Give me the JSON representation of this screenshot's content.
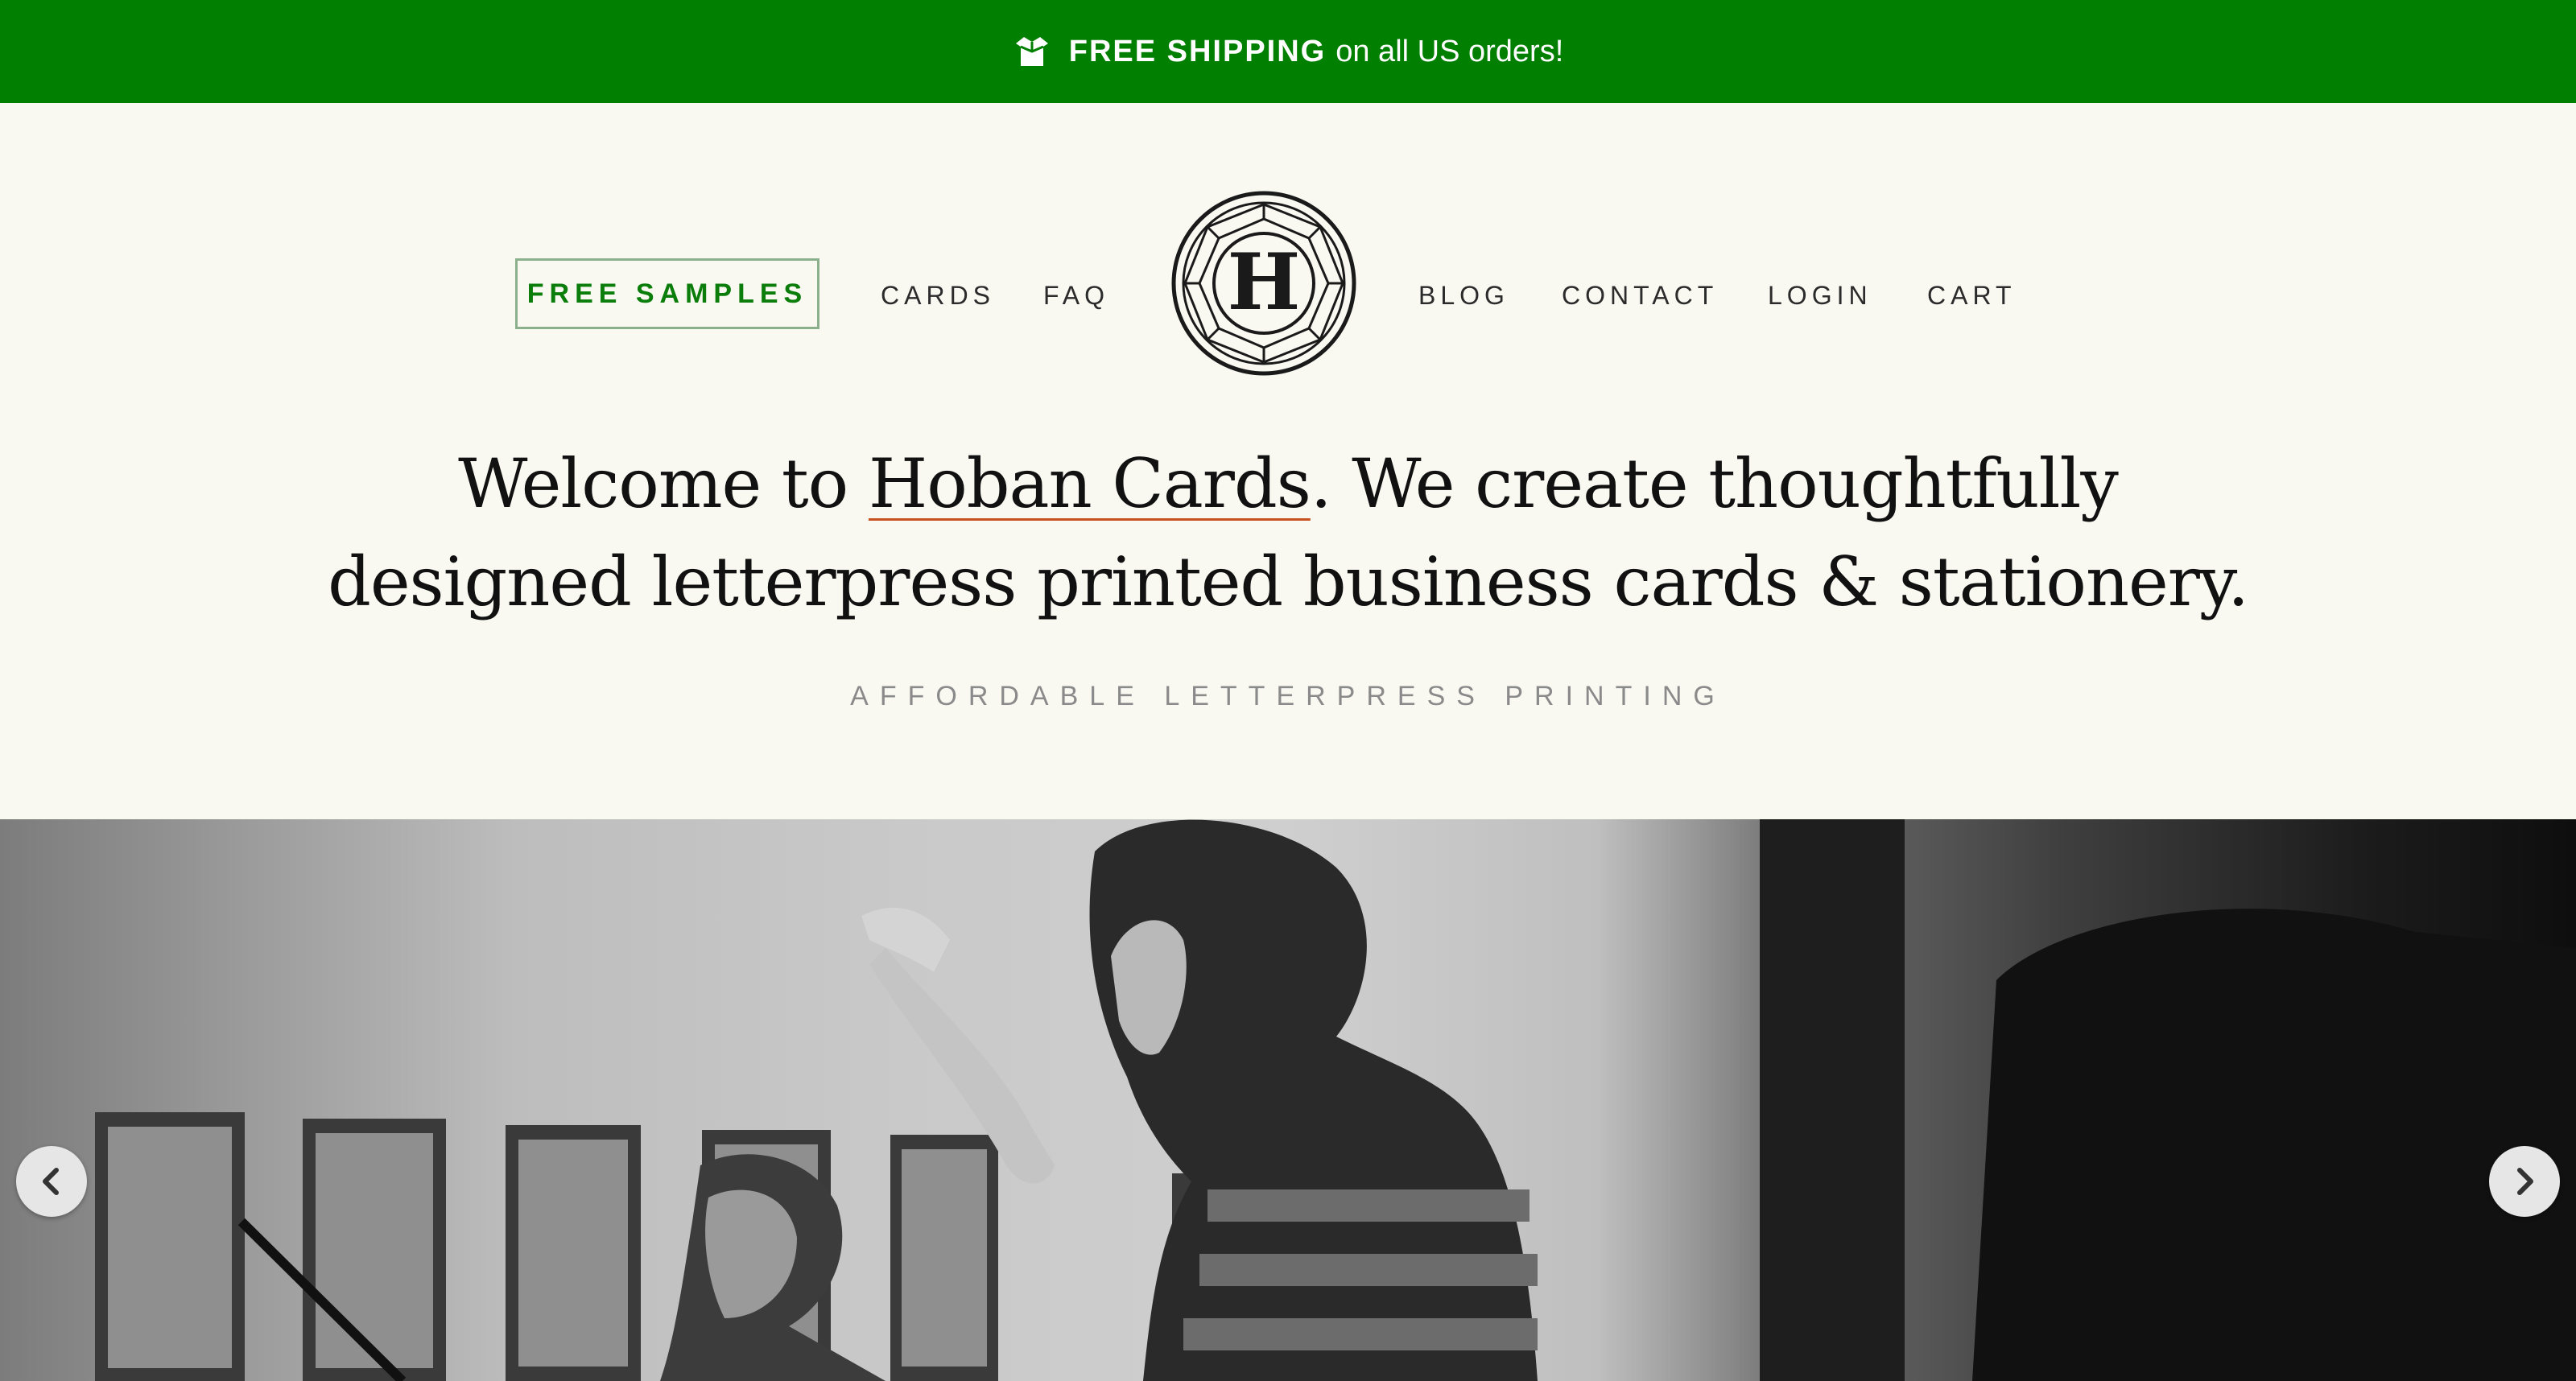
{
  "banner": {
    "icon": "box-icon",
    "strong_text": "FREE SHIPPING",
    "text": "on all US orders!",
    "bg_color": "#007f00"
  },
  "nav": {
    "free_samples": "FREE SAMPLES",
    "cards": "CARDS",
    "faq": "FAQ",
    "blog": "BLOG",
    "contact": "CONTACT",
    "login": "LOGIN",
    "cart": "CART",
    "logo_icon": "hoban-logo-icon",
    "logo_letter": "H"
  },
  "hero_text": {
    "line1_before": "Welcome to ",
    "brand": "Hoban Cards",
    "line1_after": ". We create thoughtfully",
    "line2": "designed letterpress printed business cards & stationery.",
    "tagline": "AFFORDABLE LETTERPRESS PRINTING",
    "accent_color": "#c8501e"
  },
  "carousel": {
    "prev_icon": "chevron-left-icon",
    "next_icon": "chevron-right-icon"
  }
}
